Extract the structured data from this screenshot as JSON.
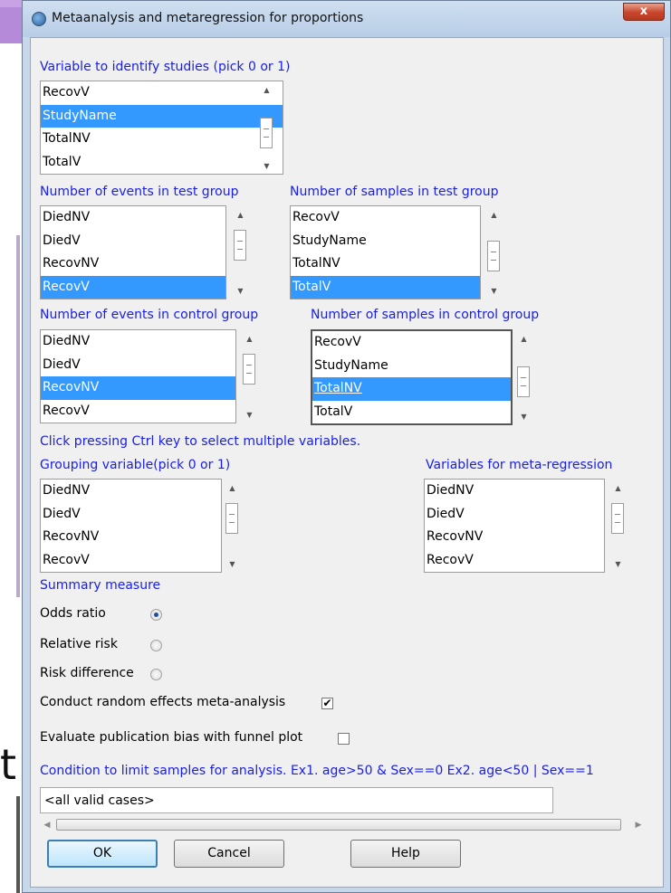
{
  "window": {
    "title": "Metaanalysis and metaregression for proportions",
    "close_label": "x"
  },
  "background_glyph": "t",
  "study_id": {
    "label": "Variable to identify studies (pick 0 or 1)",
    "items": [
      "RecovV",
      "StudyName",
      "TotalNV",
      "TotalV"
    ]
  },
  "events_test": {
    "label": "Number of events in test group",
    "items": [
      "DiedNV",
      "DiedV",
      "RecovNV",
      "RecovV"
    ]
  },
  "samples_test": {
    "label": "Number of samples in test group",
    "items": [
      "RecovV",
      "StudyName",
      "TotalNV",
      "TotalV"
    ]
  },
  "events_control": {
    "label": "Number of events in control group",
    "items": [
      "DiedNV",
      "DiedV",
      "RecovNV",
      "RecovV"
    ]
  },
  "samples_control": {
    "label": "Number of samples in control group",
    "items": [
      "RecovV",
      "StudyName",
      "TotalNV",
      "TotalV"
    ]
  },
  "ctrl_hint": "Click pressing Ctrl key to select multiple variables.",
  "grouping": {
    "label": "Grouping variable(pick 0 or 1)",
    "items": [
      "DiedNV",
      "DiedV",
      "RecovNV",
      "RecovV"
    ]
  },
  "metareg": {
    "label": "Variables for meta-regression",
    "items": [
      "DiedNV",
      "DiedV",
      "RecovNV",
      "RecovV"
    ]
  },
  "summary": {
    "label": "Summary measure",
    "options": [
      "Odds ratio",
      "Relative risk",
      "Risk difference"
    ],
    "selected": "Odds ratio"
  },
  "random_effects": {
    "label": "Conduct random effects meta-analysis",
    "checked": true,
    "mark": "✔"
  },
  "funnel_plot": {
    "label": "Evaluate publication bias with funnel plot",
    "checked": false
  },
  "condition": {
    "label": "Condition to limit samples for analysis. Ex1. age>50 & Sex==0  Ex2. age<50 | Sex==1",
    "value": "<all valid cases>"
  },
  "buttons": {
    "ok": "OK",
    "cancel": "Cancel",
    "help": "Help"
  },
  "colors": {
    "label_blue": "#1a20e6",
    "selection": "#3399ff",
    "dialog_bg": "#f0f0f0"
  }
}
